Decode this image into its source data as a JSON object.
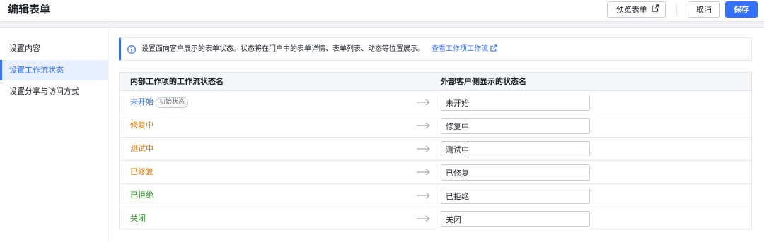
{
  "header": {
    "title": "编辑表单",
    "preview_label": "预览表单",
    "cancel_label": "取消",
    "save_label": "保存"
  },
  "sidebar": {
    "items": [
      {
        "label": "设置内容",
        "active": false
      },
      {
        "label": "设置工作流状态",
        "active": true
      },
      {
        "label": "设置分享与访问方式",
        "active": false
      }
    ]
  },
  "notice": {
    "text": "设置面向客户展示的表单状态。状态将在门户中的表单详情、表单列表、动态等位置展示。",
    "link_label": "查看工作项工作流"
  },
  "table": {
    "headers": [
      "内部工作项的工作流状态名",
      "外部客户侧显示的状态名"
    ],
    "rows": [
      {
        "status": "未开始",
        "tag": "初始状态",
        "color": "#3370ff",
        "external": "未开始"
      },
      {
        "status": "修复中",
        "color": "#de7802",
        "external": "修复中"
      },
      {
        "status": "测试中",
        "color": "#de7802",
        "external": "测试中"
      },
      {
        "status": "已修复",
        "color": "#de7802",
        "external": "已修复"
      },
      {
        "status": "已拒绝",
        "color": "#2ea121",
        "external": "已拒绝"
      },
      {
        "status": "关闭",
        "color": "#2ea121",
        "external": "关闭"
      }
    ]
  },
  "icons": {
    "preview": "external-link-icon",
    "notice": "info-icon",
    "link": "external-link-icon",
    "row_arrow": "arrow-right-icon"
  },
  "colors": {
    "accent": "#3370ff",
    "processing": "#de7802",
    "done": "#2ea121"
  }
}
